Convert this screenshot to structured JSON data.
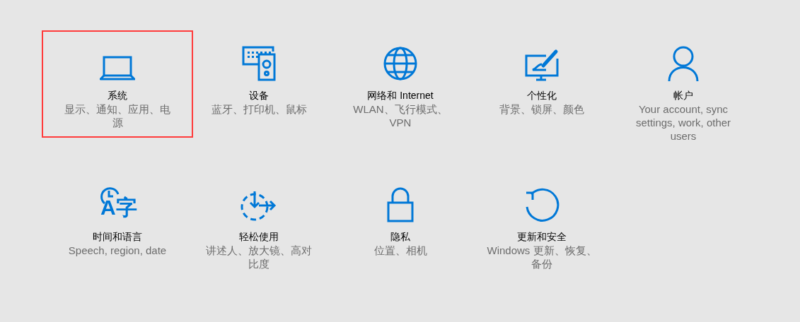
{
  "tiles": [
    {
      "title": "系统",
      "description": "显示、通知、应用、电源",
      "selected": true
    },
    {
      "title": "设备",
      "description": "蓝牙、打印机、鼠标",
      "selected": false
    },
    {
      "title": "网络和 Internet",
      "description": "WLAN、飞行模式、VPN",
      "selected": false
    },
    {
      "title": "个性化",
      "description": "背景、锁屏、颜色",
      "selected": false
    },
    {
      "title": "帐户",
      "description": "Your account, sync settings, work, other users",
      "selected": false
    },
    {
      "icon_text": "A字",
      "title": "时间和语言",
      "description": "Speech, region, date",
      "selected": false
    },
    {
      "title": "轻松使用",
      "description": "讲述人、放大镜、高对比度",
      "selected": false
    },
    {
      "title": "隐私",
      "description": "位置、相机",
      "selected": false
    },
    {
      "title": "更新和安全",
      "description": "Windows 更新、恢复、备份",
      "selected": false
    }
  ]
}
